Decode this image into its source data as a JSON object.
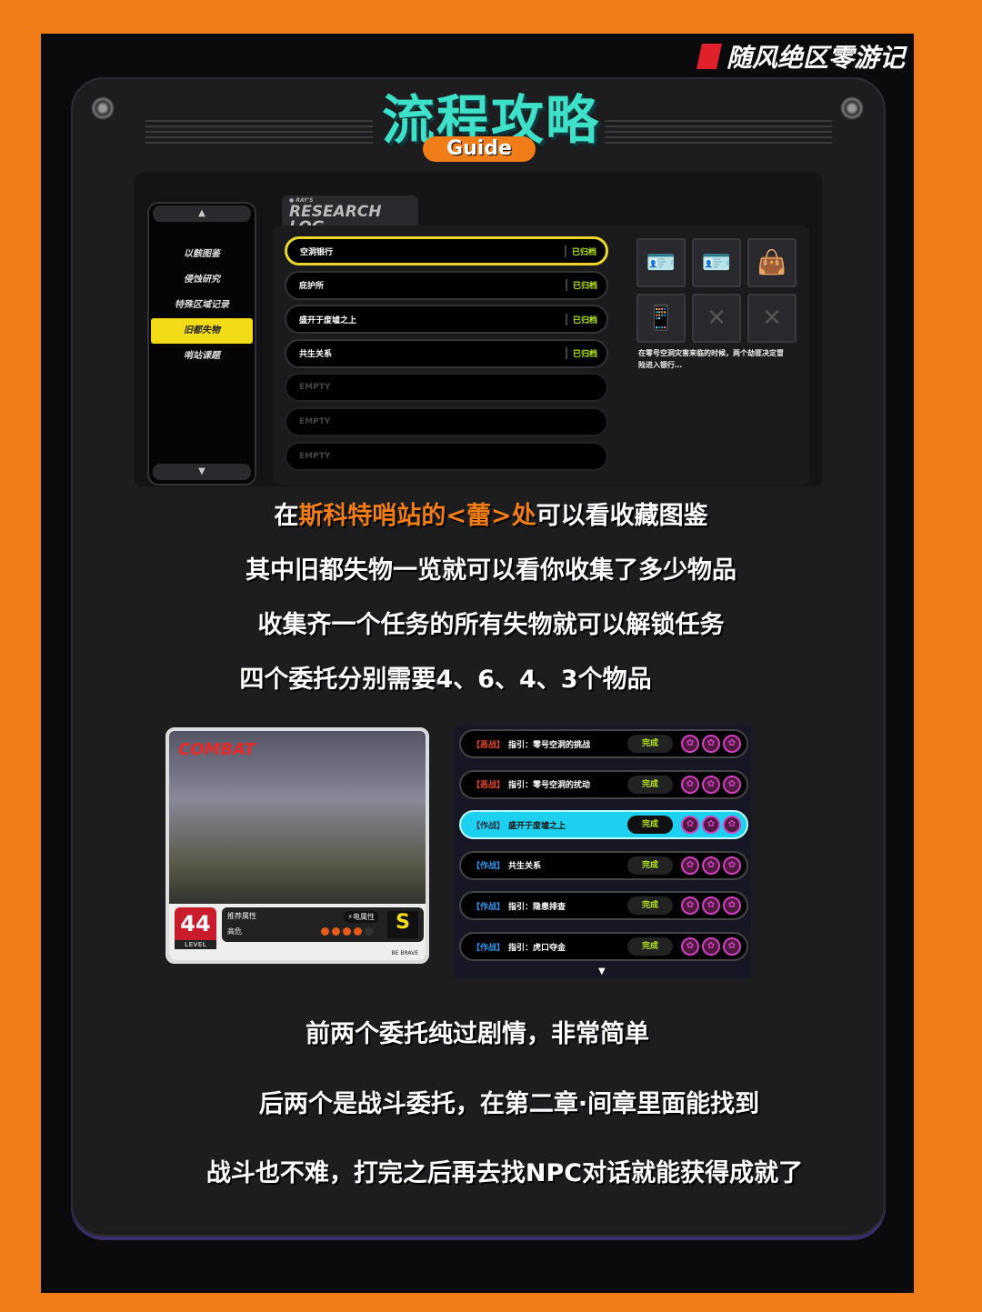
{
  "brand": "随风绝区零游记",
  "title": "流程攻略",
  "subtitle": "Guide",
  "research": {
    "tab_small": "RAY'S",
    "tab": "RESEARCH LOG",
    "sidebar": [
      "以骸图鉴",
      "侵蚀研究",
      "特殊区域记录",
      "旧都失物",
      "哨站课题"
    ],
    "active_index": 3,
    "entries": [
      {
        "name": "空洞银行",
        "status": "已归档"
      },
      {
        "name": "庇护所",
        "status": "已归档"
      },
      {
        "name": "盛开于废墟之上",
        "status": "已归档"
      },
      {
        "name": "共生关系",
        "status": "已归档"
      },
      {
        "name": "EMPTY",
        "status": ""
      },
      {
        "name": "EMPTY",
        "status": ""
      },
      {
        "name": "EMPTY",
        "status": ""
      }
    ],
    "item_icons": [
      "card-icon",
      "card-icon",
      "bag-icon",
      "phone-icon",
      "empty-slot-icon",
      "empty-slot-icon"
    ],
    "description": "在零号空洞灾害来临的时候，两个劫匪决定冒险进入银行…"
  },
  "text1": {
    "a": "在",
    "b": "斯科特哨站的<蕾>处",
    "c": "可以看收藏图鉴"
  },
  "text2": "其中旧都失物一览就可以看你收集了多少物品",
  "text3": "收集齐一个任务的所有失物就可以解锁任务",
  "text4": "四个委托分别需要4、6、4、3个物品",
  "card": {
    "label": "COMBAT",
    "level": "44",
    "level_label": "LEVEL",
    "rec_label": "推荐属性",
    "danger": "高危",
    "element": "电属性",
    "rank": "S",
    "difficulty": 4,
    "difficulty_max": 5,
    "brand": "BE BRAVE"
  },
  "quests": [
    {
      "tag": "【恶战】",
      "name": "指引：零号空洞的挑战",
      "status": "完成",
      "tag_color": "#e8482a"
    },
    {
      "tag": "【恶战】",
      "name": "指引：零号空洞的扰动",
      "status": "完成",
      "tag_color": "#e8482a"
    },
    {
      "tag": "【作战】",
      "name": "盛开于废墟之上",
      "status": "完成",
      "tag_color": "#1a2a40",
      "selected": true
    },
    {
      "tag": "【作战】",
      "name": "共生关系",
      "status": "完成",
      "tag_color": "#2a9af0"
    },
    {
      "tag": "【作战】",
      "name": "指引：隐患排查",
      "status": "完成",
      "tag_color": "#2a9af0"
    },
    {
      "tag": "【作战】",
      "name": "指引：虎口夺金",
      "status": "完成",
      "tag_color": "#2a9af0"
    }
  ],
  "text5": "前两个委托纯过剧情，非常简单",
  "text6": "后两个是战斗委托，在第二章·间章里面能找到",
  "text7": "战斗也不难，打完之后再去找NPC对话就能获得成就了"
}
